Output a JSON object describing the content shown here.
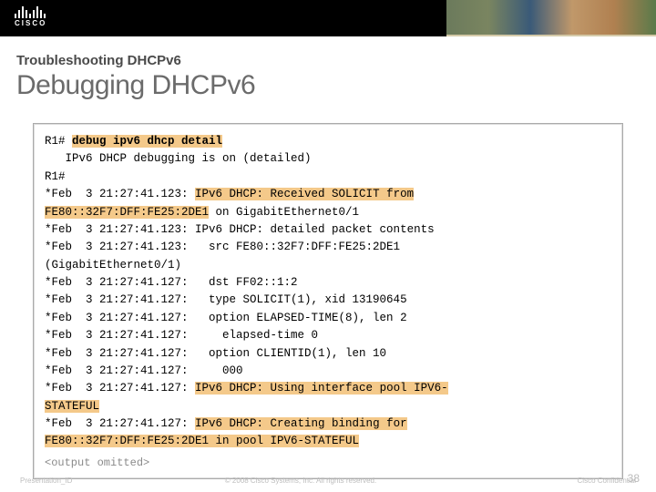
{
  "header": {
    "brand": "CISCO"
  },
  "titleBlock": {
    "subtitle": "Troubleshooting DHCPv6",
    "title": "Debugging DHCPv6"
  },
  "terminal": {
    "prompt1": "R1# ",
    "cmd": "debug ipv6 dhcp detail",
    "line2": "   IPv6 DHCP debugging is on (detailed)",
    "prompt2": "R1#",
    "l4a": "*Feb  3 21:27:41.123: ",
    "l4b": "IPv6 DHCP: Received SOLICIT from",
    "l5a": "FE80::32F7:DFF:FE25:2DE1",
    "l5b": " on GigabitEthernet0/1",
    "l6": "*Feb  3 21:27:41.123: IPv6 DHCP: detailed packet contents",
    "l7": "*Feb  3 21:27:41.123:   src FE80::32F7:DFF:FE25:2DE1",
    "l8": "(GigabitEthernet0/1)",
    "l9": "*Feb  3 21:27:41.127:   dst FF02::1:2",
    "l10": "*Feb  3 21:27:41.127:   type SOLICIT(1), xid 13190645",
    "l11": "*Feb  3 21:27:41.127:   option ELAPSED-TIME(8), len 2",
    "l12": "*Feb  3 21:27:41.127:     elapsed-time 0",
    "l13": "*Feb  3 21:27:41.127:   option CLIENTID(1), len 10",
    "l14": "*Feb  3 21:27:41.127:     000",
    "l15a": "*Feb  3 21:27:41.127: ",
    "l15b": "IPv6 DHCP: Using interface pool IPV6-",
    "l16": "STATEFUL",
    "l17a": "*Feb  3 21:27:41.127: ",
    "l17b": "IPv6 DHCP: Creating binding for",
    "l18": "FE80::32F7:DFF:FE25:2DE1 in pool IPV6-STATEFUL",
    "omitted": "<output omitted>"
  },
  "footer": {
    "pid": "Presentation_ID",
    "copyright": "© 2008 Cisco Systems, Inc. All rights reserved.",
    "confidential": "Cisco Confidential",
    "page": "38"
  }
}
